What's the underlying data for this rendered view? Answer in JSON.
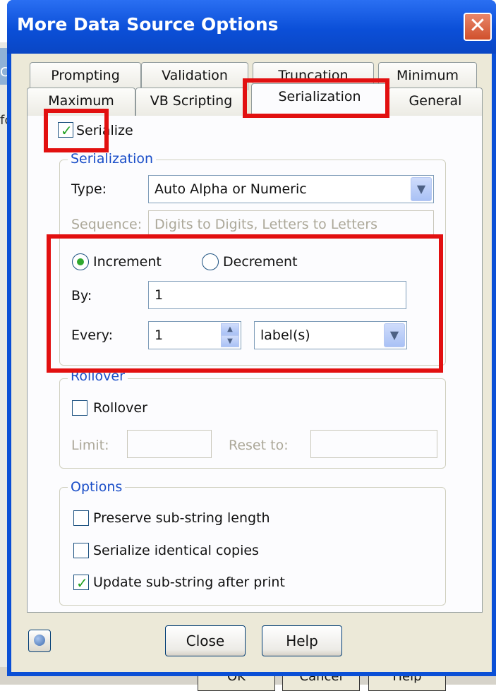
{
  "window": {
    "title": "More Data Source Options"
  },
  "background": {
    "side_letters": [
      "C",
      "fc"
    ],
    "buttons": [
      "OK",
      "Cancel",
      "Help"
    ]
  },
  "tabs": {
    "row1": [
      "Prompting",
      "Validation",
      "Truncation",
      "Minimum"
    ],
    "row2": [
      "Maximum",
      "VB Scripting",
      "Serialization",
      "General"
    ],
    "active": "Serialization"
  },
  "serialize": {
    "label": "Serialize",
    "checked": true
  },
  "serialization_group": {
    "title": "Serialization",
    "type_label": "Type:",
    "type_value": "Auto Alpha or Numeric",
    "sequence_label": "Sequence:",
    "sequence_value": "Digits to Digits, Letters to Letters",
    "increment_label": "Increment",
    "decrement_label": "Decrement",
    "direction_selected": "Increment",
    "by_label": "By:",
    "by_value": "1",
    "every_label": "Every:",
    "every_value": "1",
    "every_unit": "label(s)"
  },
  "rollover_group": {
    "title": "Rollover",
    "rollover_label": "Rollover",
    "rollover_checked": false,
    "limit_label": "Limit:",
    "limit_value": "",
    "reset_label": "Reset to:",
    "reset_value": ""
  },
  "options_group": {
    "title": "Options",
    "items": [
      {
        "label": "Preserve sub-string length",
        "checked": false
      },
      {
        "label": "Serialize identical copies",
        "checked": false
      },
      {
        "label": "Update sub-string after print",
        "checked": true
      }
    ]
  },
  "buttons": {
    "close": "Close",
    "help": "Help"
  },
  "icons": {
    "help_button": "help-balloon-icon",
    "close_title": "close-icon"
  },
  "colors": {
    "highlight": "#e21010",
    "titlebar": "#0b4fd8",
    "group_title": "#1a4ec8"
  }
}
